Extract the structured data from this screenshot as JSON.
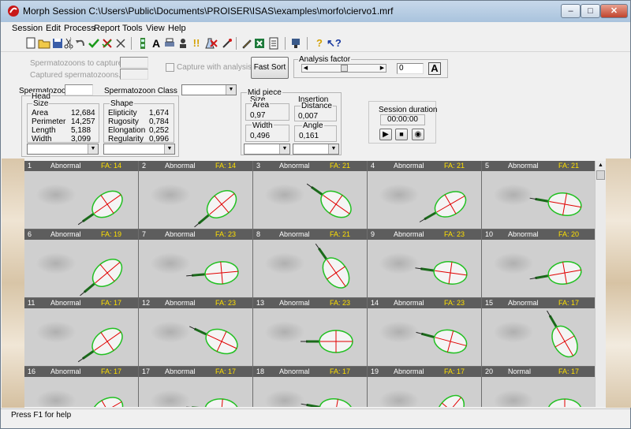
{
  "window": {
    "title": "Morph Session C:\\Users\\Public\\Documents\\PROISER\\ISAS\\examples\\morfo\\ciervo1.mrf"
  },
  "menu": [
    "Session",
    "Edit",
    "Process",
    "Report",
    "Tools",
    "View",
    "Help"
  ],
  "capture": {
    "spermatozoons_to_capture": "Spermatozoons to capture.......",
    "captured_spermatozoons": "Captured spermatozoons.......",
    "capture_with_analysis": "Capture with analysis",
    "fast_sort": "Fast Sort",
    "analysis_factor": "Analysis factor",
    "analysis_factor_value": "0",
    "analysis_factor_level": 0.5
  },
  "spermatozoon": {
    "label": "Spermatozoon",
    "class_label": "Spermatozoon Class"
  },
  "head": {
    "label": "Head",
    "size_label": "Size",
    "size": [
      {
        "k": "Area",
        "v": "12,684"
      },
      {
        "k": "Perimeter",
        "v": "14,257"
      },
      {
        "k": "Length",
        "v": "5,188"
      },
      {
        "k": "Width",
        "v": "3,099"
      }
    ],
    "shape_label": "Shape",
    "shape": [
      {
        "k": "Elipticity",
        "v": "1,674"
      },
      {
        "k": "Rugosity",
        "v": "0,784"
      },
      {
        "k": "Elongation",
        "v": "0,252"
      },
      {
        "k": "Regularity",
        "v": "0,996"
      }
    ]
  },
  "midpiece": {
    "label": "Mid piece",
    "size_label": "Size",
    "area_label": "Area",
    "area": "0,97",
    "width_label": "Width",
    "width": "0,496",
    "insertion_label": "Insertion",
    "distance_label": "Distance",
    "distance": "0,007",
    "angle_label": "Angle",
    "angle": "0,161"
  },
  "session": {
    "duration_label": "Session duration",
    "duration": "00:00:00"
  },
  "cells": [
    {
      "num": "1",
      "cls": "Abnormal",
      "fa": "FA: 14",
      "angle": -35
    },
    {
      "num": "2",
      "cls": "Abnormal",
      "fa": "FA: 14",
      "angle": -40
    },
    {
      "num": "3",
      "cls": "Abnormal",
      "fa": "FA: 21",
      "angle": 35
    },
    {
      "num": "4",
      "cls": "Abnormal",
      "fa": "FA: 21",
      "angle": -30
    },
    {
      "num": "5",
      "cls": "Abnormal",
      "fa": "FA: 21",
      "angle": 10
    },
    {
      "num": "6",
      "cls": "Abnormal",
      "fa": "FA: 19",
      "angle": -40
    },
    {
      "num": "7",
      "cls": "Abnormal",
      "fa": "FA: 23",
      "angle": -5
    },
    {
      "num": "8",
      "cls": "Abnormal",
      "fa": "FA: 21",
      "angle": 55
    },
    {
      "num": "9",
      "cls": "Abnormal",
      "fa": "FA: 23",
      "angle": 8
    },
    {
      "num": "10",
      "cls": "Abnormal",
      "fa": "FA: 20",
      "angle": -10
    },
    {
      "num": "11",
      "cls": "Abnormal",
      "fa": "FA: 17",
      "angle": -35
    },
    {
      "num": "12",
      "cls": "Abnormal",
      "fa": "FA: 23",
      "angle": 25
    },
    {
      "num": "13",
      "cls": "Abnormal",
      "fa": "FA: 23",
      "angle": 0
    },
    {
      "num": "14",
      "cls": "Abnormal",
      "fa": "FA: 23",
      "angle": 15
    },
    {
      "num": "15",
      "cls": "Abnormal",
      "fa": "FA: 17",
      "angle": 60
    },
    {
      "num": "16",
      "cls": "Abnormal",
      "fa": "FA: 17",
      "angle": -30
    },
    {
      "num": "17",
      "cls": "Abnormal",
      "fa": "FA: 17",
      "angle": 5
    },
    {
      "num": "18",
      "cls": "Abnormal",
      "fa": "FA: 17",
      "angle": 10
    },
    {
      "num": "19",
      "cls": "Abnormal",
      "fa": "FA: 17",
      "angle": -50
    },
    {
      "num": "20",
      "cls": "Normal",
      "fa": "FA: 17",
      "angle": 0
    }
  ],
  "status": "Press F1 for help",
  "colors": {
    "accent_fa": "#ffe000",
    "contour": "#22c022",
    "axis": "#e00000"
  }
}
